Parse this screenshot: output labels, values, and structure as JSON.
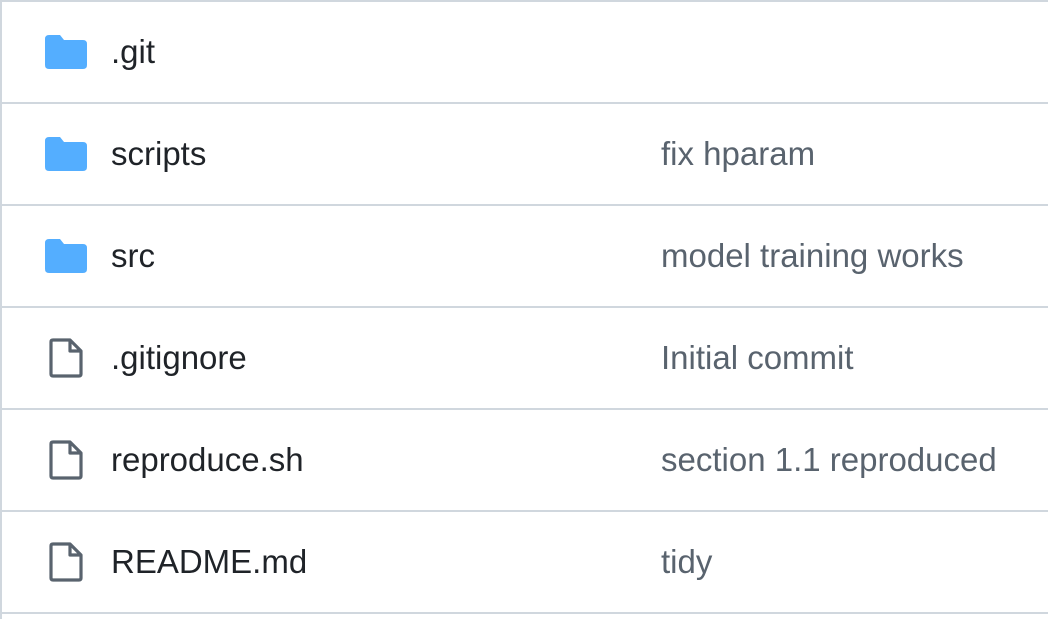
{
  "colors": {
    "folder_icon": "#54aeff",
    "file_icon": "#59636e",
    "name_text": "#1f2328",
    "commit_text": "#59636e",
    "border": "#d0d7de"
  },
  "files": [
    {
      "name": ".git",
      "type": "folder",
      "icon": "folder-icon",
      "commit_message": ""
    },
    {
      "name": "scripts",
      "type": "folder",
      "icon": "folder-icon",
      "commit_message": "fix hparam"
    },
    {
      "name": "src",
      "type": "folder",
      "icon": "folder-icon",
      "commit_message": "model training works"
    },
    {
      "name": ".gitignore",
      "type": "file",
      "icon": "file-icon",
      "commit_message": "Initial commit"
    },
    {
      "name": "reproduce.sh",
      "type": "file",
      "icon": "file-icon",
      "commit_message": "section 1.1 reproduced"
    },
    {
      "name": "README.md",
      "type": "file",
      "icon": "file-icon",
      "commit_message": "tidy"
    }
  ]
}
